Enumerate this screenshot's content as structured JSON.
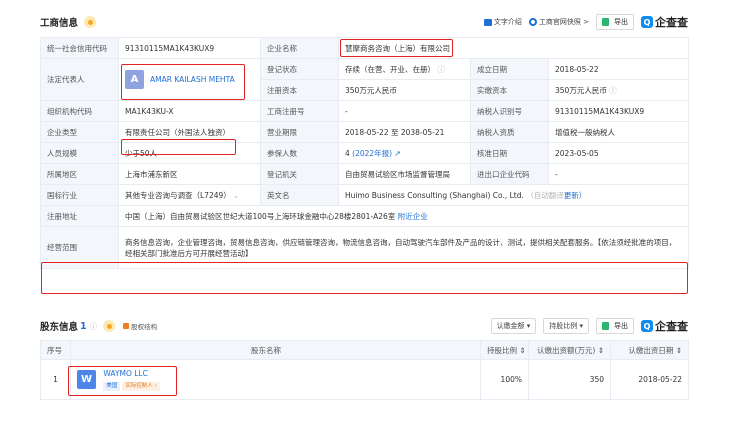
{
  "header": {
    "title": "工商信息",
    "text_intro": "文字介绍",
    "official_snapshot": "工商官网快照 >",
    "export": "导出",
    "brand": "企查查",
    "brand_logo": "Q"
  },
  "info": {
    "credit_code_label": "统一社会信用代码",
    "credit_code": "91310115MA1K43KUX9",
    "company_name_label": "企业名称",
    "company_name": "慧摩商务咨询（上海）有限公司",
    "legal_rep_label": "法定代表人",
    "legal_rep_avatar": "A",
    "legal_rep": "AMAR KAILASH MEHTA",
    "reg_status_label": "登记状态",
    "reg_status": "存续（在营、开业、在册）",
    "est_date_label": "成立日期",
    "est_date": "2018-05-22",
    "reg_capital_label": "注册资本",
    "reg_capital": "350万元人民币",
    "paid_capital_label": "实缴资本",
    "paid_capital": "350万元人民币",
    "org_code_label": "组织机构代码",
    "org_code": "MA1K43KU-X",
    "biz_reg_no_label": "工商注册号",
    "biz_reg_no": "-",
    "taxpayer_id_label": "纳税人识别号",
    "taxpayer_id": "91310115MA1K43KUX9",
    "company_type_label": "企业类型",
    "company_type": "有限责任公司（外国法人独资）",
    "biz_term_label": "营业期限",
    "biz_term": "2018-05-22 至 2038-05-21",
    "taxpayer_qual_label": "纳税人资质",
    "taxpayer_qual": "增值税一般纳税人",
    "staff_size_label": "人员规模",
    "staff_size": "少于50人",
    "insured_label": "参保人数",
    "insured": "4",
    "insured_year": "(2022年报)",
    "approve_date_label": "核准日期",
    "approve_date": "2023-05-05",
    "region_label": "所属地区",
    "region": "上海市浦东新区",
    "reg_authority_label": "登记机关",
    "reg_authority": "自由贸易试验区市场监督管理局",
    "import_export_label": "进出口企业代码",
    "import_export": "-",
    "industry_label": "国标行业",
    "industry": "其他专业咨询与调查（L7249）",
    "english_name_label": "英文名",
    "english_name": "Huimo Business Consulting (Shanghai) Co., Ltd.",
    "english_name_note": "（自动翻译",
    "english_name_update": "更新）",
    "address_label": "注册地址",
    "address": "中国（上海）自由贸易试验区世纪大道100号上海环球金融中心28楼2801-A26室",
    "address_link": "附近企业",
    "scope_label": "经营范围",
    "scope": "商务信息咨询，企业管理咨询，贸易信息咨询，供应链管理咨询，物流信息咨询，自动驾驶汽车部件及产品的设计、测试，提供相关配套服务。【依法须经批准的项目，经相关部门批准后方可开展经营活动】"
  },
  "shareholders": {
    "title": "股东信息",
    "count": "1",
    "equity_structure": "股权结构",
    "filter_amount": "认缴金额 ▾",
    "filter_ratio": "持股比例 ▾",
    "export": "导出",
    "brand": "企查查",
    "columns": {
      "index": "序号",
      "name": "股东名称",
      "ratio": "持股比例 ⇕",
      "amount": "认缴出资额(万元) ⇕",
      "date": "认缴出资日期 ⇕"
    },
    "rows": [
      {
        "index": "1",
        "logo": "W",
        "name": "WAYMO LLC",
        "tag_country": "美国",
        "tag_role": "实际控制人 ›",
        "ratio": "100%",
        "amount": "350",
        "date": "2018-05-22"
      }
    ]
  }
}
